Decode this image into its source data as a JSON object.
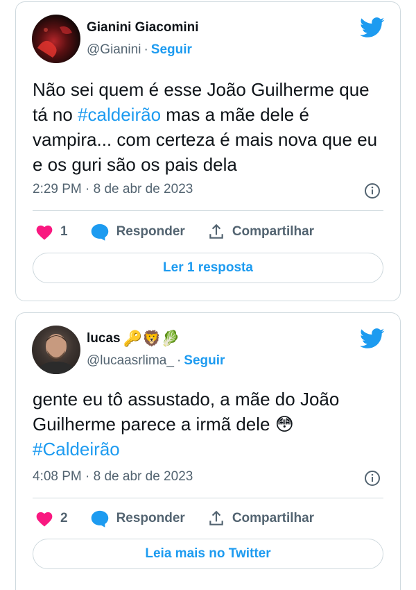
{
  "tweets": [
    {
      "author_name": "Gianini Giacomini",
      "handle": "@Gianini",
      "separator": "·",
      "follow_label": "Seguir",
      "text_before": "Não sei quem é esse João Guilherme que tá no ",
      "hashtag": "#caldeirão",
      "text_after": " mas a mãe dele é vampira... com certeza é mais nova que eu e os guri são os pais dela",
      "timestamp": "2:29 PM · 8 de abr de 2023",
      "like_count": "1",
      "reply_label": "Responder",
      "share_label": "Compartilhar",
      "footer_button": "Ler 1 resposta"
    },
    {
      "author_name": "lucas",
      "name_emojis": "🔑🦁🥬",
      "handle": "@lucaasrlima_",
      "separator": "·",
      "follow_label": "Seguir",
      "text_line": "gente eu tô assustado, a mãe do João Guilherme parece a irmã dele",
      "text_emoji": "😳",
      "hashtag": "#Caldeirão",
      "timestamp": "4:08 PM · 8 de abr de 2023",
      "like_count": "2",
      "reply_label": "Responder",
      "share_label": "Compartilhar",
      "footer_button": "Leia mais no Twitter"
    }
  ],
  "colors": {
    "accent": "#1d9bf0",
    "like": "#f91880",
    "text": "#0f1419",
    "muted": "#536471",
    "border": "#cfd9de"
  },
  "icons": [
    "twitter-bird-icon",
    "heart-icon",
    "reply-bubble-icon",
    "share-icon",
    "info-icon"
  ]
}
